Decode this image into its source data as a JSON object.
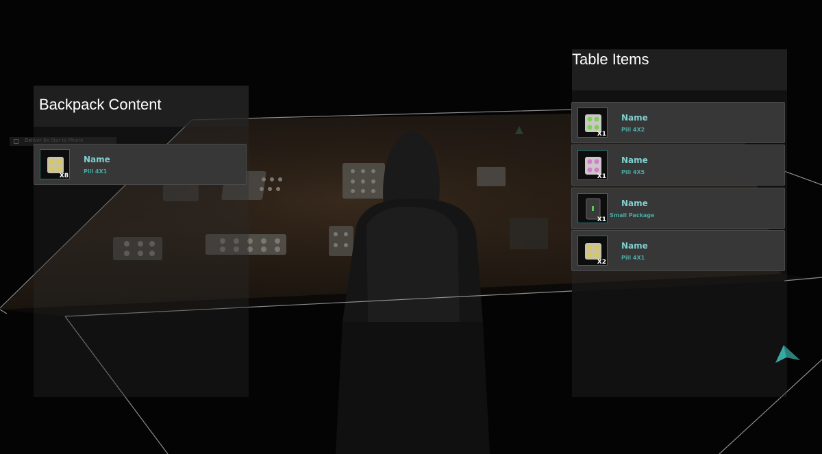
{
  "objective": {
    "text": "Deliver 8x Star to Phone"
  },
  "backpack": {
    "title": "Backpack Content",
    "items": [
      {
        "name": "Name",
        "subtitle": "Pill 4X1",
        "quantity": "X8",
        "icon": "pill-4x1-icon"
      }
    ]
  },
  "table": {
    "title": "Table Items",
    "items": [
      {
        "name": "Name",
        "subtitle": "Pill 4X2",
        "quantity": "X1",
        "icon": "pill-4x2-icon"
      },
      {
        "name": "Name",
        "subtitle": "Pill 4X5",
        "quantity": "X1",
        "icon": "pill-4x5-icon"
      },
      {
        "name": "Name",
        "subtitle": "Small Package",
        "quantity": "X1",
        "icon": "small-package-icon"
      },
      {
        "name": "Name",
        "subtitle": "Pill 4X1",
        "quantity": "X2",
        "icon": "pill-4x1-icon"
      }
    ]
  },
  "colors": {
    "accent": "#7fd0cf",
    "accent_dark": "#4aa9a5",
    "slot_bg": "#373737",
    "arrow": "#3aa8a3"
  }
}
